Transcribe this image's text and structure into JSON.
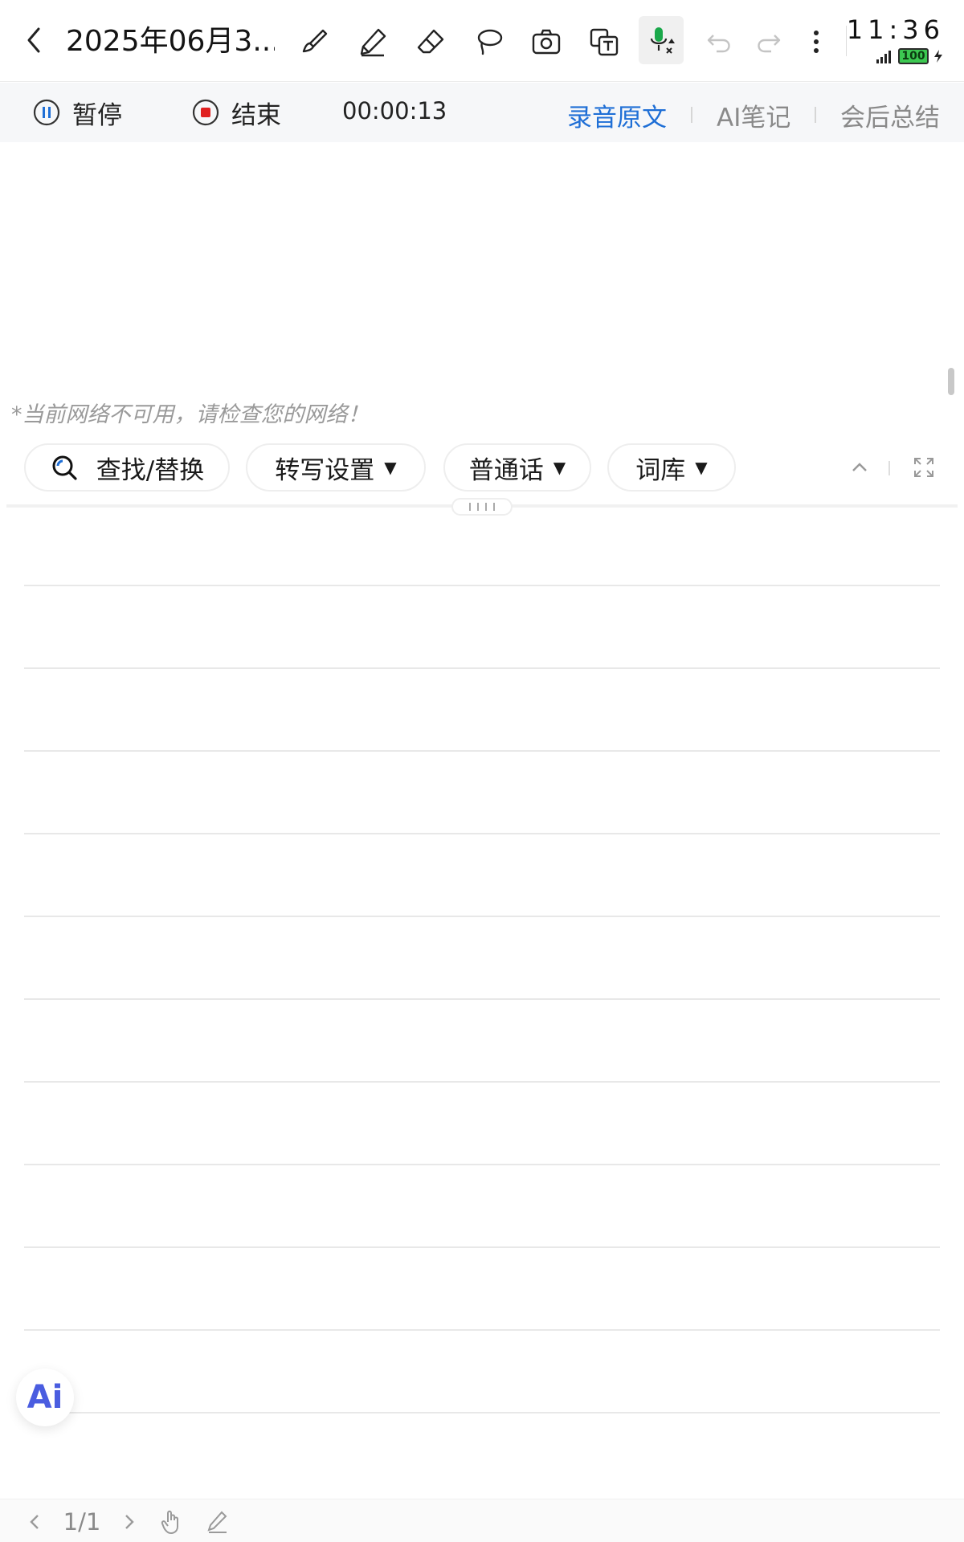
{
  "header": {
    "title": "2025年06月3...",
    "tools": [
      "back-icon",
      "brush-icon",
      "pencil-icon",
      "eraser-icon",
      "lasso-icon",
      "camera-icon",
      "translate-icon",
      "mic-icon",
      "undo-icon",
      "redo-icon",
      "more-icon"
    ]
  },
  "status": {
    "time": "11:36",
    "battery": "100"
  },
  "recording": {
    "pause_label": "暂停",
    "stop_label": "结束",
    "timer": "00:00:13",
    "tabs": [
      {
        "label": "录音原文",
        "active": true
      },
      {
        "label": "AI笔记",
        "active": false
      },
      {
        "label": "会后总结",
        "active": false
      }
    ]
  },
  "transcript": {
    "network_message": "*当前网络不可用，请检查您的网络！"
  },
  "toolbar": {
    "search_label": "查找/替换",
    "transcribe_label": "转写设置",
    "language_label": "普通话",
    "lexicon_label": "词库"
  },
  "ai_button": {
    "label": "Ai"
  },
  "footer": {
    "page_indicator": "1/1"
  },
  "colors": {
    "accent": "#1f6fd6",
    "record_red": "#e02020",
    "mic_green": "#1aa84a"
  }
}
